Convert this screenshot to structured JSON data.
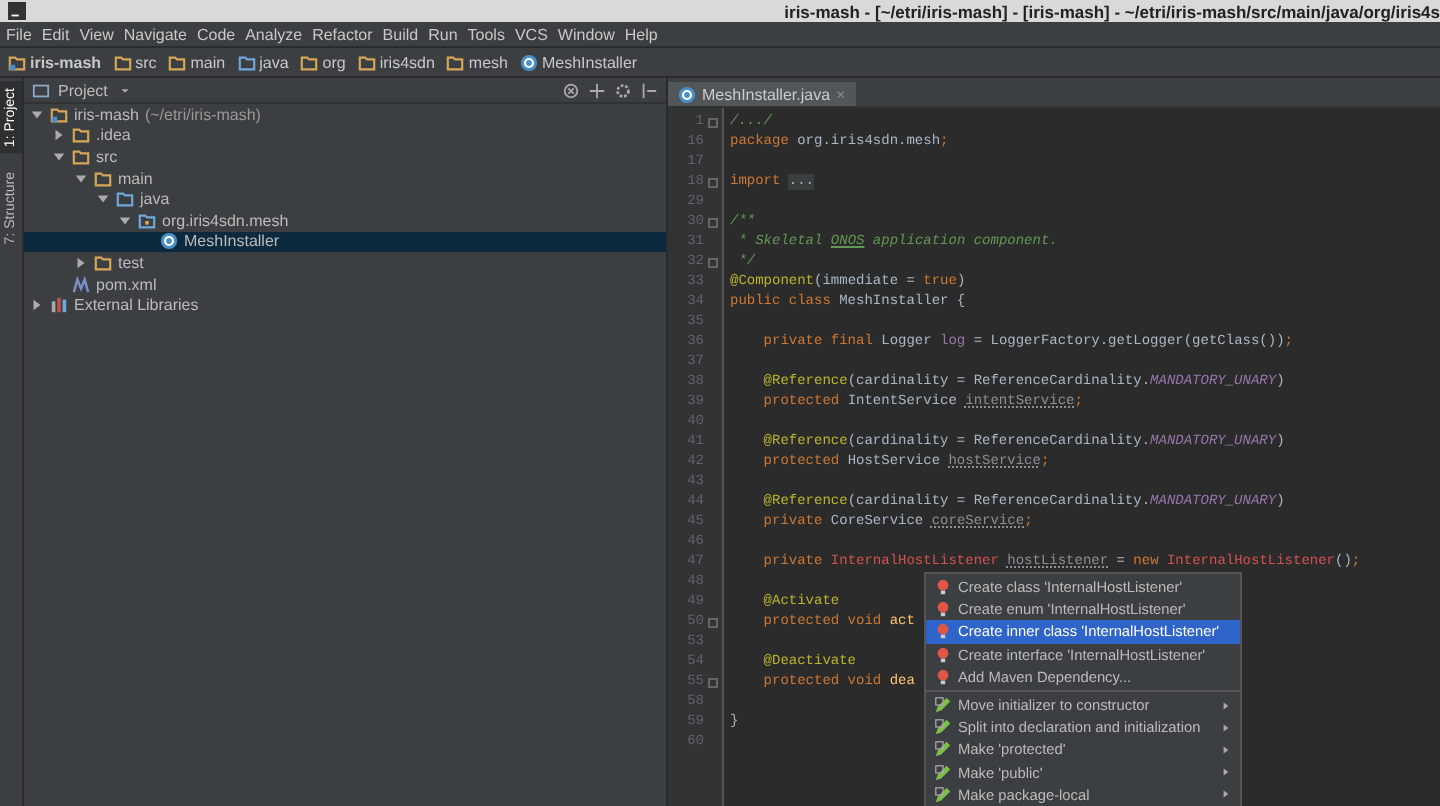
{
  "window": {
    "title": "iris-mash - [~/etri/iris-mash] - [iris-mash] - ~/etri/iris-mash/src/main/java/org/iris4s"
  },
  "menu": [
    "File",
    "Edit",
    "View",
    "Navigate",
    "Code",
    "Analyze",
    "Refactor",
    "Build",
    "Run",
    "Tools",
    "VCS",
    "Window",
    "Help"
  ],
  "breadcrumbs": [
    {
      "label": "iris-mash",
      "kind": "module"
    },
    {
      "label": "src",
      "kind": "folder"
    },
    {
      "label": "main",
      "kind": "folder"
    },
    {
      "label": "java",
      "kind": "source"
    },
    {
      "label": "org",
      "kind": "folder"
    },
    {
      "label": "iris4sdn",
      "kind": "folder"
    },
    {
      "label": "mesh",
      "kind": "folder"
    },
    {
      "label": "MeshInstaller",
      "kind": "class"
    }
  ],
  "tool_strip": [
    {
      "label": "1: Project",
      "selected": true
    },
    {
      "label": "7: Structure",
      "selected": false
    }
  ],
  "project_panel": {
    "title": "Project",
    "tree": [
      {
        "label": "iris-mash",
        "hint": "(~/etri/iris-mash)",
        "kind": "module",
        "expanded": true,
        "selected": false,
        "children": [
          {
            "label": ".idea",
            "kind": "folder",
            "expanded": false,
            "selected": false
          },
          {
            "label": "src",
            "kind": "folder",
            "expanded": true,
            "selected": false,
            "children": [
              {
                "label": "main",
                "kind": "folder",
                "expanded": true,
                "selected": false,
                "children": [
                  {
                    "label": "java",
                    "kind": "source",
                    "expanded": true,
                    "selected": false,
                    "children": [
                      {
                        "label": "org.iris4sdn.mesh",
                        "kind": "package",
                        "expanded": true,
                        "selected": false,
                        "children": [
                          {
                            "label": "MeshInstaller",
                            "kind": "class",
                            "selected": true
                          }
                        ]
                      }
                    ]
                  }
                ]
              },
              {
                "label": "test",
                "kind": "folder",
                "expanded": false,
                "selected": false
              }
            ]
          },
          {
            "label": "pom.xml",
            "kind": "maven",
            "selected": false
          }
        ]
      },
      {
        "label": "External Libraries",
        "kind": "libraries",
        "expanded": false,
        "selected": false
      }
    ]
  },
  "editor": {
    "tabs": [
      {
        "label": "MeshInstaller.java",
        "close": "×",
        "selected": true
      }
    ],
    "lines": [
      {
        "number": "1",
        "fold": true,
        "tokens": [
          {
            "text": "/.../",
            "kind": "comment"
          }
        ]
      },
      {
        "number": "16",
        "fold": false,
        "tokens": [
          {
            "text": "package ",
            "kind": "keyword"
          },
          {
            "text": "org.iris4sdn.mesh",
            "kind": "plain"
          },
          {
            "text": ";",
            "kind": "keyword"
          }
        ]
      },
      {
        "number": "17",
        "fold": false
      },
      {
        "number": "18",
        "fold": true,
        "tokens": [
          {
            "text": "import ",
            "kind": "keyword"
          },
          {
            "text": "...",
            "kind": "folded"
          }
        ]
      },
      {
        "number": "29",
        "fold": false
      },
      {
        "number": "30",
        "fold": true,
        "tokens": [
          {
            "text": "/**",
            "kind": "comment"
          }
        ]
      },
      {
        "number": "31",
        "fold": false,
        "tokens": [
          {
            "text": " * Skeletal ",
            "kind": "comment"
          },
          {
            "text": "ONOS",
            "kind": "comment-typo"
          },
          {
            "text": " application component.",
            "kind": "comment"
          }
        ]
      },
      {
        "number": "32",
        "fold": true,
        "tokens": [
          {
            "text": " */",
            "kind": "comment"
          }
        ]
      },
      {
        "number": "33",
        "fold": false,
        "tokens": [
          {
            "text": "@Component",
            "kind": "annotation"
          },
          {
            "text": "(immediate = ",
            "kind": "plain"
          },
          {
            "text": "true",
            "kind": "keyword"
          },
          {
            "text": ")",
            "kind": "plain"
          }
        ]
      },
      {
        "number": "34",
        "fold": false,
        "tokens": [
          {
            "text": "public class ",
            "kind": "keyword"
          },
          {
            "text": "MeshInstaller {",
            "kind": "plain"
          }
        ]
      },
      {
        "number": "35",
        "fold": false
      },
      {
        "number": "36",
        "fold": false,
        "tokens": [
          {
            "text": "    private final ",
            "kind": "keyword"
          },
          {
            "text": "Logger ",
            "kind": "plain"
          },
          {
            "text": "log",
            "kind": "field"
          },
          {
            "text": " = LoggerFactory.getLogger(getClass())",
            "kind": "plain"
          },
          {
            "text": ";",
            "kind": "keyword"
          }
        ]
      },
      {
        "number": "37",
        "fold": false
      },
      {
        "number": "38",
        "fold": false,
        "tokens": [
          {
            "text": "    @Reference",
            "kind": "annotation"
          },
          {
            "text": "(cardinality = ReferenceCardinality.",
            "kind": "plain"
          },
          {
            "text": "MANDATORY_UNARY",
            "kind": "constant"
          },
          {
            "text": ")",
            "kind": "plain"
          }
        ]
      },
      {
        "number": "39",
        "fold": false,
        "tokens": [
          {
            "text": "    protected ",
            "kind": "keyword"
          },
          {
            "text": "IntentService ",
            "kind": "plain"
          },
          {
            "text": "intentService",
            "kind": "unused"
          },
          {
            "text": ";",
            "kind": "keyword"
          }
        ]
      },
      {
        "number": "40",
        "fold": false
      },
      {
        "number": "41",
        "fold": false,
        "tokens": [
          {
            "text": "    @Reference",
            "kind": "annotation"
          },
          {
            "text": "(cardinality = ReferenceCardinality.",
            "kind": "plain"
          },
          {
            "text": "MANDATORY_UNARY",
            "kind": "constant"
          },
          {
            "text": ")",
            "kind": "plain"
          }
        ]
      },
      {
        "number": "42",
        "fold": false,
        "tokens": [
          {
            "text": "    protected ",
            "kind": "keyword"
          },
          {
            "text": "HostService ",
            "kind": "plain"
          },
          {
            "text": "hostService",
            "kind": "unused"
          },
          {
            "text": ";",
            "kind": "keyword"
          }
        ]
      },
      {
        "number": "43",
        "fold": false
      },
      {
        "number": "44",
        "fold": false,
        "tokens": [
          {
            "text": "    @Reference",
            "kind": "annotation"
          },
          {
            "text": "(cardinality = ReferenceCardinality.",
            "kind": "plain"
          },
          {
            "text": "MANDATORY_UNARY",
            "kind": "constant"
          },
          {
            "text": ")",
            "kind": "plain"
          }
        ]
      },
      {
        "number": "45",
        "fold": false,
        "tokens": [
          {
            "text": "    private ",
            "kind": "keyword"
          },
          {
            "text": "CoreService ",
            "kind": "plain"
          },
          {
            "text": "coreService",
            "kind": "unused"
          },
          {
            "text": ";",
            "kind": "keyword"
          }
        ]
      },
      {
        "number": "46",
        "fold": false
      },
      {
        "number": "47",
        "fold": false,
        "tokens": [
          {
            "text": "    private ",
            "kind": "keyword"
          },
          {
            "text": "InternalHostListener ",
            "kind": "error"
          },
          {
            "text": "hostListener",
            "kind": "unused"
          },
          {
            "text": " = ",
            "kind": "plain"
          },
          {
            "text": "new ",
            "kind": "keyword"
          },
          {
            "text": "InternalHostListener",
            "kind": "error"
          },
          {
            "text": "()",
            "kind": "plain"
          },
          {
            "text": ";",
            "kind": "keyword"
          }
        ]
      },
      {
        "number": "48",
        "fold": false
      },
      {
        "number": "49",
        "fold": false,
        "tokens": [
          {
            "text": "    @Activate",
            "kind": "annotation"
          }
        ]
      },
      {
        "number": "50",
        "fold": true,
        "tokens": [
          {
            "text": "    protected void ",
            "kind": "keyword"
          },
          {
            "text": "act",
            "kind": "method"
          }
        ]
      },
      {
        "number": "53",
        "fold": false
      },
      {
        "number": "54",
        "fold": false,
        "tokens": [
          {
            "text": "    @Deactivate",
            "kind": "annotation"
          }
        ]
      },
      {
        "number": "55",
        "fold": true,
        "tokens": [
          {
            "text": "    protected void ",
            "kind": "keyword"
          },
          {
            "text": "dea",
            "kind": "method"
          }
        ]
      },
      {
        "number": "58",
        "fold": false
      },
      {
        "number": "59",
        "fold": false,
        "tokens": [
          {
            "text": "}",
            "kind": "plain"
          }
        ]
      },
      {
        "number": "60",
        "fold": false
      }
    ],
    "quick_fix_menu": [
      {
        "label": "Create class 'InternalHostListener'",
        "kind": "fix",
        "selected": false
      },
      {
        "label": "Create enum 'InternalHostListener'",
        "kind": "fix",
        "selected": false
      },
      {
        "label": "Create inner class 'InternalHostListener'",
        "kind": "fix",
        "selected": true
      },
      {
        "label": "Create interface 'InternalHostListener'",
        "kind": "fix",
        "selected": false
      },
      {
        "label": "Add Maven Dependency...",
        "kind": "fix",
        "selected": false
      },
      {
        "label": "Move initializer to constructor",
        "kind": "intention",
        "selected": false
      },
      {
        "label": "Split into declaration and initialization",
        "kind": "intention",
        "selected": false
      },
      {
        "label": "Make 'protected'",
        "kind": "intention",
        "selected": false
      },
      {
        "label": "Make 'public'",
        "kind": "intention",
        "selected": false
      },
      {
        "label": "Make package-local",
        "kind": "intention",
        "selected": false
      }
    ]
  }
}
